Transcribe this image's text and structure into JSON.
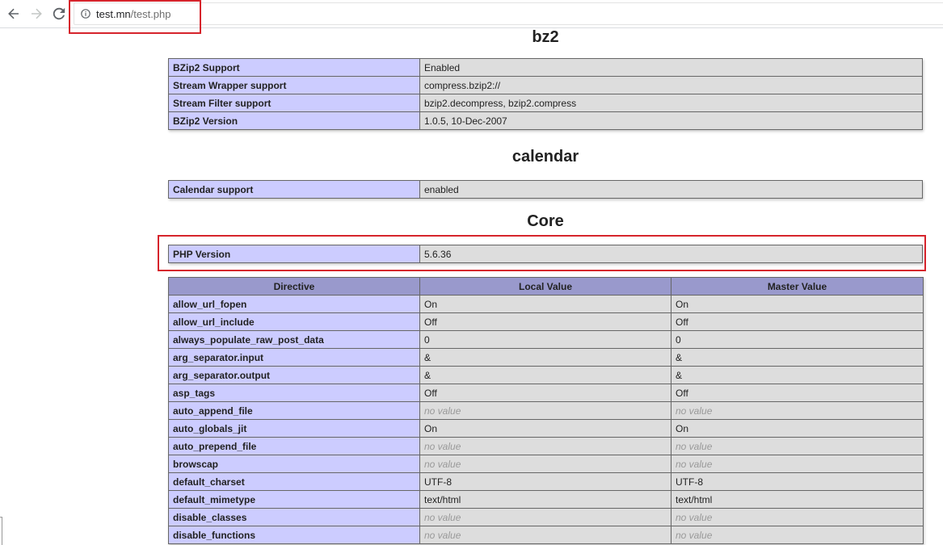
{
  "browser": {
    "url_domain": "test.mn",
    "url_path": "/test.php"
  },
  "sections": {
    "bz2": {
      "title": "bz2",
      "rows": [
        {
          "name": "BZip2 Support",
          "value": "Enabled"
        },
        {
          "name": "Stream Wrapper support",
          "value": "compress.bzip2://"
        },
        {
          "name": "Stream Filter support",
          "value": "bzip2.decompress, bzip2.compress"
        },
        {
          "name": "BZip2 Version",
          "value": "1.0.5, 10-Dec-2007"
        }
      ]
    },
    "calendar": {
      "title": "calendar",
      "rows": [
        {
          "name": "Calendar support",
          "value": "enabled"
        }
      ]
    },
    "core": {
      "title": "Core",
      "php_version_label": "PHP Version",
      "php_version_value": "5.6.36",
      "headers": [
        "Directive",
        "Local Value",
        "Master Value"
      ],
      "directives": [
        {
          "name": "allow_url_fopen",
          "local": "On",
          "master": "On"
        },
        {
          "name": "allow_url_include",
          "local": "Off",
          "master": "Off"
        },
        {
          "name": "always_populate_raw_post_data",
          "local": "0",
          "master": "0"
        },
        {
          "name": "arg_separator.input",
          "local": "&",
          "master": "&"
        },
        {
          "name": "arg_separator.output",
          "local": "&",
          "master": "&"
        },
        {
          "name": "asp_tags",
          "local": "Off",
          "master": "Off"
        },
        {
          "name": "auto_append_file",
          "local": "no value",
          "master": "no value"
        },
        {
          "name": "auto_globals_jit",
          "local": "On",
          "master": "On"
        },
        {
          "name": "auto_prepend_file",
          "local": "no value",
          "master": "no value"
        },
        {
          "name": "browscap",
          "local": "no value",
          "master": "no value"
        },
        {
          "name": "default_charset",
          "local": "UTF-8",
          "master": "UTF-8"
        },
        {
          "name": "default_mimetype",
          "local": "text/html",
          "master": "text/html"
        },
        {
          "name": "disable_classes",
          "local": "no value",
          "master": "no value"
        },
        {
          "name": "disable_functions",
          "local": "no value",
          "master": "no value"
        }
      ]
    }
  },
  "colors": {
    "highlight_border": "#d6242c",
    "header_bg": "#9999cc",
    "name_bg": "#ccccff",
    "value_bg": "#dddddd"
  }
}
